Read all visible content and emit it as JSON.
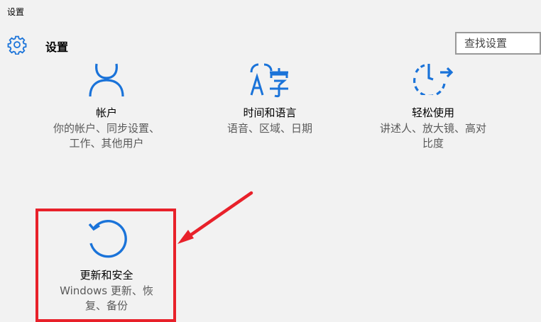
{
  "window": {
    "title": "设置"
  },
  "header": {
    "title": "设置",
    "icon": "gear-icon"
  },
  "search": {
    "placeholder": "查找设置"
  },
  "tiles": [
    {
      "name": "帐户",
      "desc_lines": [
        "你的帐户、同步设置、",
        "工作、其他用户"
      ],
      "icon": "person-icon"
    },
    {
      "name": "时间和语言",
      "desc_lines": [
        "语音、区域、日期"
      ],
      "icon": "language-icon"
    },
    {
      "name": "轻松使用",
      "desc_lines": [
        "讲述人、放大镜、高对",
        "比度"
      ],
      "icon": "ease-of-access-icon"
    },
    {
      "name": "更新和安全",
      "desc_lines": [
        "Windows 更新、恢",
        "复、备份"
      ],
      "icon": "refresh-icon"
    }
  ],
  "colors": {
    "accent": "#1a73d9",
    "annotation": "#e8212a",
    "background": "#f2f2f2"
  }
}
